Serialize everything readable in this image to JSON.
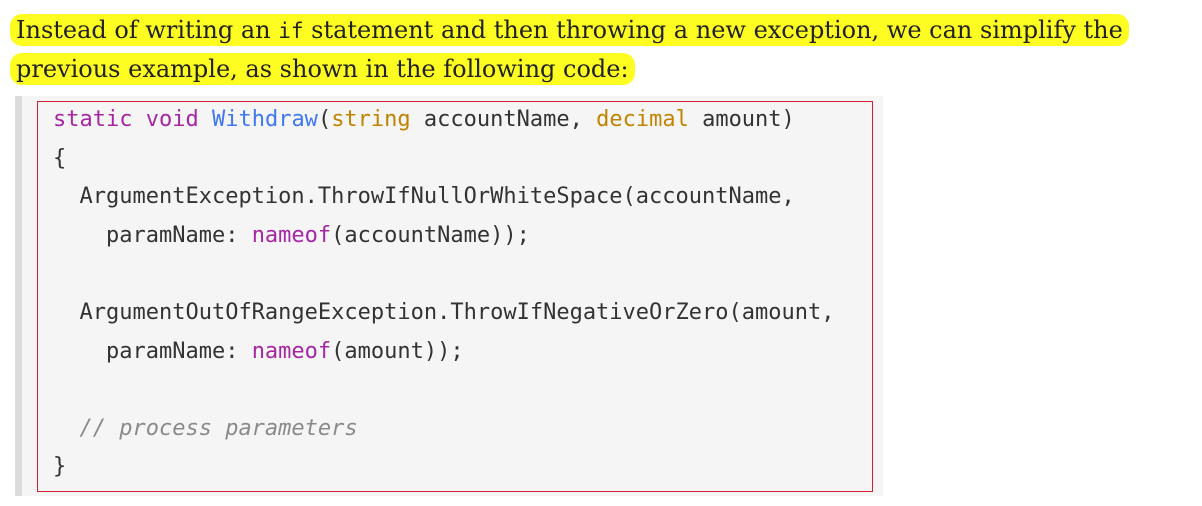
{
  "paragraph": {
    "part1": "Instead of writing an ",
    "code": "if",
    "part2": " statement and then throwing a new exception, we can simplify the previous example, as shown in the following code:"
  },
  "code": {
    "l1_static": "static",
    "l1_void": "void",
    "l1_method": "Withdraw",
    "l1_open": "(",
    "l1_t1": "string",
    "l1_p1": " accountName, ",
    "l1_t2": "decimal",
    "l1_p2": " amount)",
    "l2_brace": "{",
    "l3_call": "ArgumentException.ThrowIfNullOrWhiteSpace(accountName,",
    "l4_param": "paramName: ",
    "l4_nameof": "nameof",
    "l4_arg": "(accountName));",
    "l6_call": "ArgumentOutOfRangeException.ThrowIfNegativeOrZero(amount,",
    "l7_param": "paramName: ",
    "l7_nameof": "nameof",
    "l7_arg": "(amount));",
    "l9_comment": "// process parameters",
    "l10_brace": "}"
  },
  "colors": {
    "highlight": "#fdfd22",
    "keyword": "#a626a4",
    "method": "#4078f2",
    "type": "#c18401",
    "comment": "#8a8a8a",
    "selection_border": "#d12033"
  }
}
